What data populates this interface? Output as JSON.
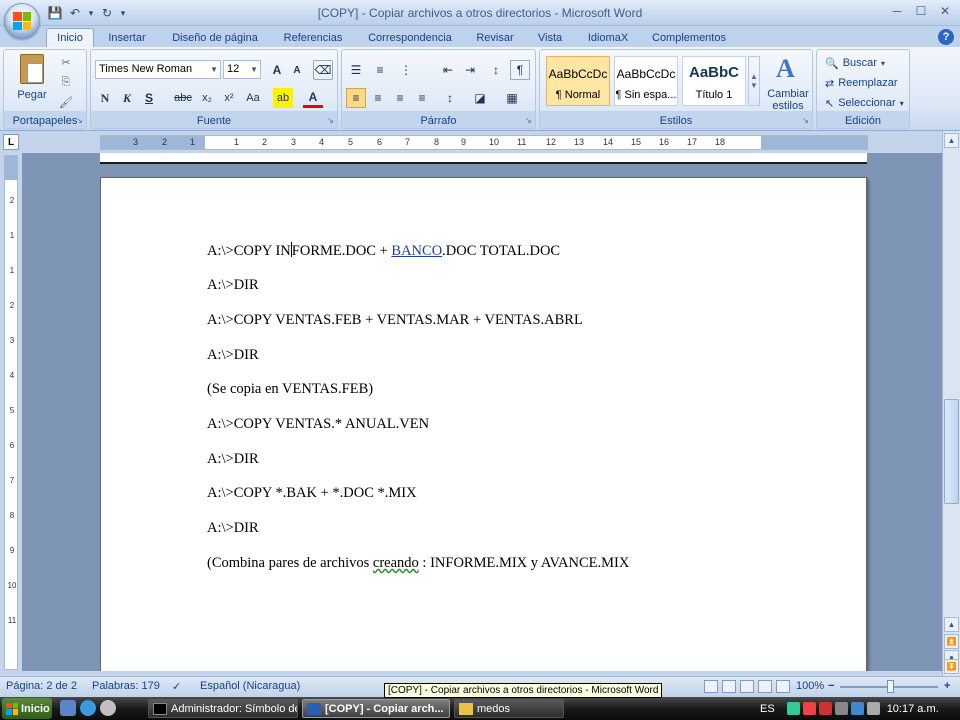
{
  "window": {
    "title": "[COPY] - Copiar archivos a otros directorios - Microsoft Word",
    "minimize": "─",
    "maximize": "☐",
    "close": "✕"
  },
  "qat": {
    "save": "💾",
    "undo": "↶",
    "redo": "↻",
    "more": "▾"
  },
  "tabs": [
    "Inicio",
    "Insertar",
    "Diseño de página",
    "Referencias",
    "Correspondencia",
    "Revisar",
    "Vista",
    "IdiomaX",
    "Complementos"
  ],
  "ribbon": {
    "clipboard": {
      "label": "Portapapeles",
      "paste": "Pegar"
    },
    "font": {
      "label": "Fuente",
      "font_name": "Times New Roman",
      "font_size": "12",
      "bold": "N",
      "italic": "K",
      "underline": "S",
      "strike": "abc",
      "subscript": "x₂",
      "superscript": "x²",
      "change_case": "Aa",
      "grow": "A",
      "shrink": "A",
      "highlight": "ab",
      "font_color": "A"
    },
    "paragraph": {
      "label": "Párrafo"
    },
    "styles": {
      "label": "Estilos",
      "items": [
        {
          "sample": "AaBbCcDc",
          "name": "¶ Normal"
        },
        {
          "sample": "AaBbCcDc",
          "name": "¶ Sin espa..."
        },
        {
          "sample": "AaBbC",
          "name": "Título 1"
        }
      ],
      "change_styles": "Cambiar estilos"
    },
    "editing": {
      "label": "Edición",
      "find": "Buscar",
      "replace": "Reemplazar",
      "select": "Seleccionar"
    }
  },
  "ruler": {
    "h_ticks": [
      "3",
      "2",
      "1",
      "1",
      "2",
      "3",
      "4",
      "5",
      "6",
      "7",
      "8",
      "9",
      "10",
      "11",
      "12",
      "13",
      "14",
      "15",
      "16",
      "17",
      "18"
    ],
    "v_ticks": [
      "2",
      "1",
      "1",
      "2",
      "3",
      "4",
      "5",
      "6",
      "7",
      "8",
      "9",
      "10",
      "11"
    ]
  },
  "document": {
    "line1_pre": "A:\\>COPY IN",
    "line1_mid": "FORME.DOC + ",
    "line1_link": "BANCO",
    "line1_post": ".DOC TOTAL.DOC",
    "line2": "A:\\>DIR",
    "line3": "A:\\>COPY VENTAS.FEB + VENTAS.MAR + VENTAS.ABRL",
    "line4": "A:\\>DIR",
    "line5": "(Se copia  en VENTAS.FEB)",
    "line6": "A:\\>COPY VENTAS.* ANUAL.VEN",
    "line7": "A:\\>DIR",
    "line8": "A:\\>COPY *.BAK + *.DOC *.MIX",
    "line9": "A:\\>DIR",
    "line10_pre": "(Combina pares  de archivos ",
    "line10_squig": "creando",
    "line10_post": " : INFORME.MIX y AVANCE.MIX"
  },
  "status": {
    "page": "Página: 2 de 2",
    "words": "Palabras: 179",
    "language": "Español (Nicaragua)",
    "zoom": "100%",
    "zoom_minus": "−",
    "zoom_plus": "+"
  },
  "tooltip": "[COPY] - Copiar archivos a otros directorios - Microsoft Word",
  "taskbar": {
    "start": "Inicio",
    "tasks": [
      "Administrador: Símbolo de...",
      "[COPY] - Copiar arch...",
      "medos"
    ],
    "lang": "ES",
    "clock": "10:17 a.m."
  },
  "colors": {
    "link": "#1f3fa6",
    "ribbon_bg": "#dce7f5",
    "accent": "#15428b"
  }
}
